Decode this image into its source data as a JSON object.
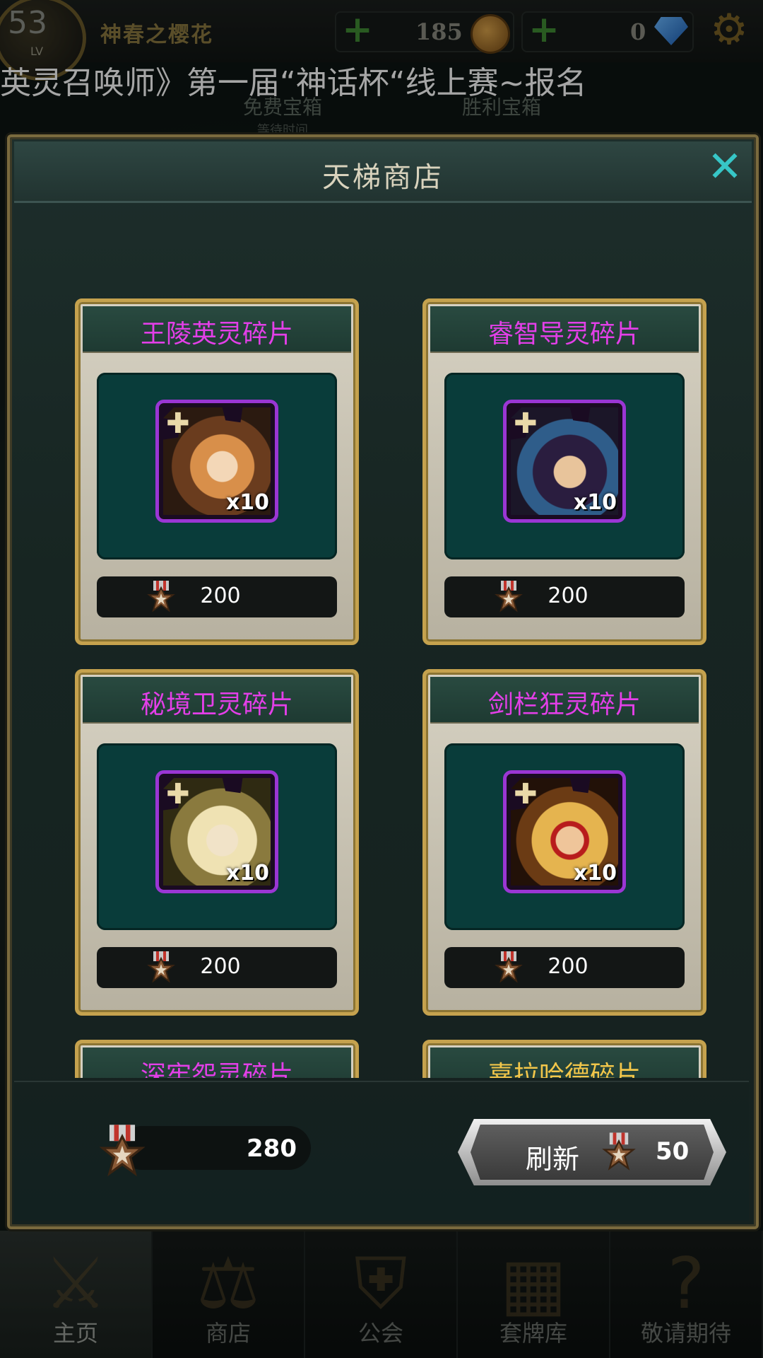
{
  "top_bar": {
    "level": "53",
    "level_label": "LV",
    "player_name": "神春之樱花",
    "gold": "185",
    "gems": "0"
  },
  "announcement": "英灵召唤师》第一届“神话杯“线上赛~报名",
  "background_cards": {
    "free_chest": "免费宝箱",
    "free_chest_sub": "等待时间",
    "victory_chest": "胜利宝箱"
  },
  "shop": {
    "title": "天梯商店",
    "items": [
      {
        "name": "王陵英灵碎片",
        "quantity": "x10",
        "price": "200",
        "name_color": "purple"
      },
      {
        "name": "睿智导灵碎片",
        "quantity": "x10",
        "price": "200",
        "name_color": "purple"
      },
      {
        "name": "秘境卫灵碎片",
        "quantity": "x10",
        "price": "200",
        "name_color": "purple"
      },
      {
        "name": "剑栏狂灵碎片",
        "quantity": "x10",
        "price": "200",
        "name_color": "purple"
      },
      {
        "name": "深牢怨灵碎片",
        "name_color": "purple"
      },
      {
        "name": "嘉拉哈德碎片",
        "name_color": "gold"
      }
    ],
    "balance": "280",
    "refresh_label": "刷新",
    "refresh_cost": "50"
  },
  "bottom_nav": [
    {
      "label": "主页",
      "icon": "crossed-swords-icon",
      "active": true
    },
    {
      "label": "商店",
      "icon": "scales-icon"
    },
    {
      "label": "公会",
      "icon": "guild-crest-icon"
    },
    {
      "label": "套牌库",
      "icon": "cards-icon"
    },
    {
      "label": "敬请期待",
      "icon": "question-mark-icon"
    }
  ],
  "colors": {
    "item_name_purple": "#e33fe8",
    "item_name_gold": "#f2c64a",
    "close_button": "#37c6c7",
    "card_border": "#c5a24e"
  }
}
